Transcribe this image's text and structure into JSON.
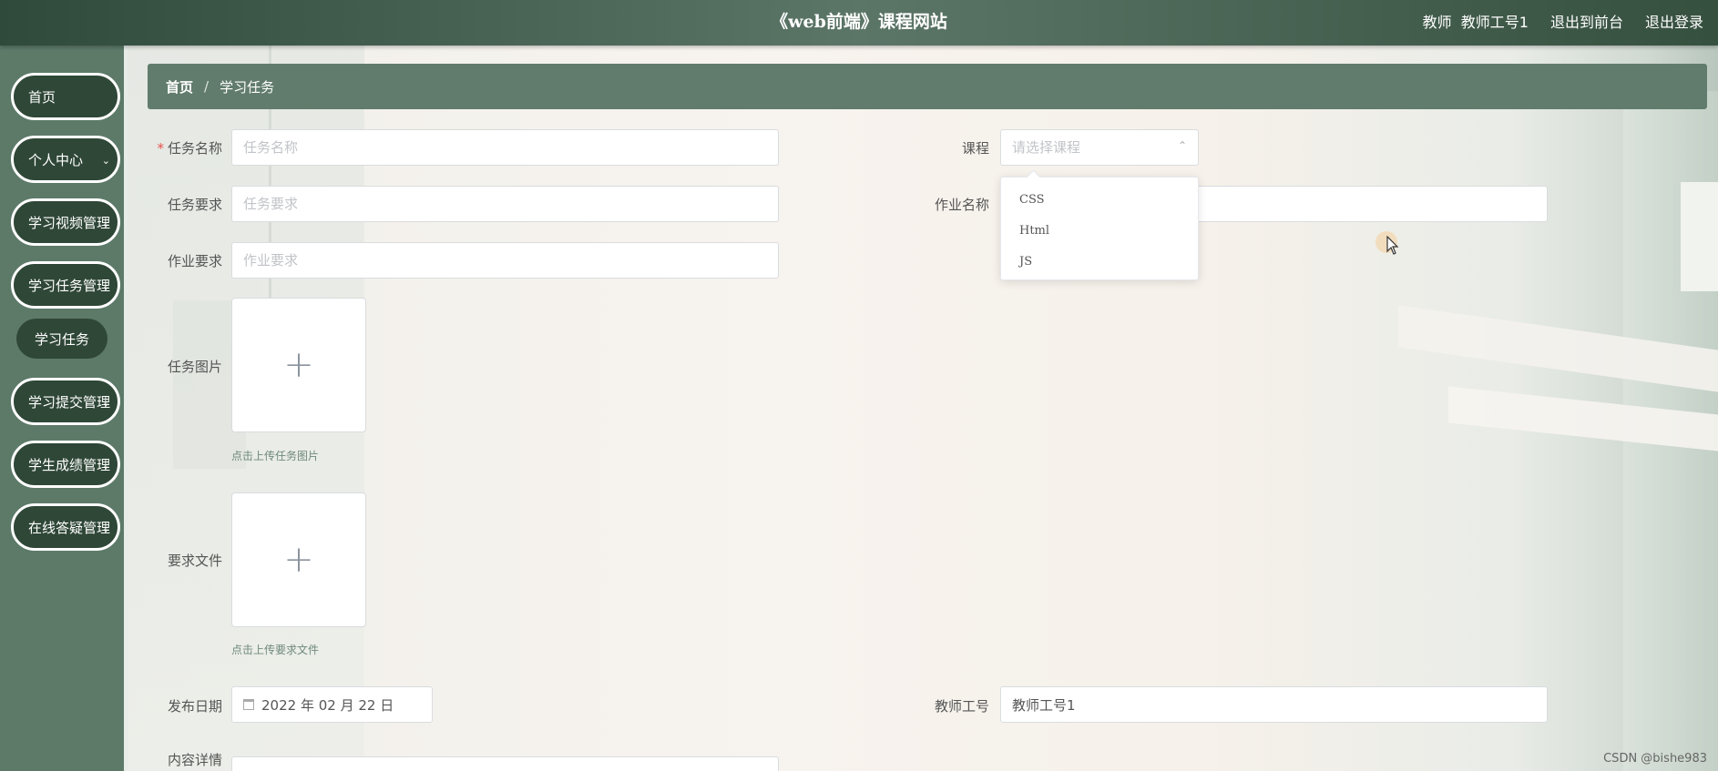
{
  "header": {
    "title": "《web前端》课程网站",
    "user_role": "教师",
    "user_name": "教师工号1",
    "exit_front": "退出到前台",
    "logout": "退出登录"
  },
  "sidebar": {
    "items": [
      {
        "label": "首页",
        "has_children": false
      },
      {
        "label": "个人中心",
        "has_children": true
      },
      {
        "label": "学习视频管理",
        "has_children": true
      },
      {
        "label": "学习任务管理",
        "has_children": true,
        "expanded": true
      },
      {
        "label": "学习提交管理",
        "has_children": true
      },
      {
        "label": "学生成绩管理",
        "has_children": true
      },
      {
        "label": "在线答疑管理",
        "has_children": true
      }
    ],
    "submenu": {
      "label": "学习任务"
    }
  },
  "breadcrumb": {
    "home": "首页",
    "separator": "/",
    "current": "学习任务"
  },
  "form": {
    "task_name": {
      "label": "任务名称",
      "placeholder": "任务名称",
      "required_mark": "*"
    },
    "course": {
      "label": "课程",
      "placeholder": "请选择课程"
    },
    "task_requirement": {
      "label": "任务要求",
      "placeholder": "任务要求"
    },
    "homework_name": {
      "label": "作业名称",
      "placeholder": ""
    },
    "homework_requirement": {
      "label": "作业要求",
      "placeholder": "作业要求"
    },
    "task_image": {
      "label": "任务图片",
      "tip": "点击上传任务图片",
      "plus": "+"
    },
    "requirement_file": {
      "label": "要求文件",
      "tip": "点击上传要求文件",
      "plus": "+"
    },
    "publish_date": {
      "label": "发布日期",
      "value": "2022 年 02 月 22 日"
    },
    "teacher_id": {
      "label": "教师工号",
      "value": "教师工号1"
    },
    "content_detail": {
      "label": "内容详情"
    }
  },
  "course_dropdown": {
    "options": [
      "CSS",
      "Html",
      "JS"
    ]
  },
  "watermark": "CSDN @bishe983",
  "colors": {
    "sidebar_bg": "#5d7a69",
    "menu_item_bg": "#2f4737",
    "breadcrumb_bg": "#617c6c",
    "required": "#e8524d"
  }
}
